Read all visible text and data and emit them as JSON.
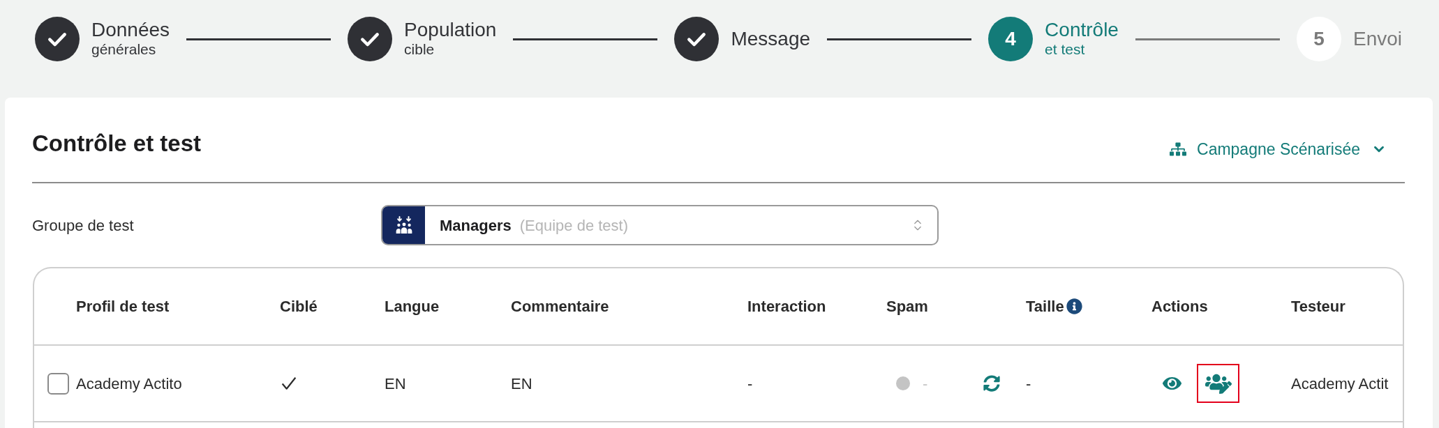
{
  "steps": [
    {
      "label": "Données",
      "sublabel": "générales",
      "completed": true,
      "selected": false
    },
    {
      "label": "Population",
      "sublabel": "cible",
      "completed": true,
      "selected": false
    },
    {
      "label": "Message",
      "completed": true,
      "selected": false
    },
    {
      "number": "4",
      "label": "Contrôle",
      "sublabel": "et test",
      "completed": false,
      "selected": true
    },
    {
      "number": "5",
      "label": "Envoi",
      "completed": false,
      "selected": false
    }
  ],
  "page": {
    "title": "Contrôle et test",
    "campaign_type": "Campagne Scénarisée"
  },
  "test_group": {
    "label": "Groupe de test",
    "value": "Managers",
    "detail": "(Equipe de test)"
  },
  "table": {
    "columns": [
      {
        "label": "Profil de test",
        "info": false
      },
      {
        "label": "Ciblé",
        "info": false
      },
      {
        "label": "Langue",
        "info": false
      },
      {
        "label": "Commentaire",
        "info": false
      },
      {
        "label": "Interaction",
        "info": false
      },
      {
        "label": "Spam",
        "info": false
      },
      {
        "label": "Taille",
        "info": true
      },
      {
        "label": "Actions",
        "info": false
      },
      {
        "label": "Testeur",
        "info": false
      }
    ],
    "rows": [
      {
        "profile": "Academy Actito",
        "checked": false,
        "targeted": true,
        "language": "EN",
        "comment": "EN",
        "interaction": "-",
        "spam": {
          "color": "#c4c4c4",
          "value": "-"
        },
        "size": "-",
        "actions": [
          {
            "kind": "preview",
            "highlighted": false
          },
          {
            "kind": "edit_testers",
            "highlighted": true
          }
        ],
        "tester": "Academy Actit"
      }
    ]
  }
}
